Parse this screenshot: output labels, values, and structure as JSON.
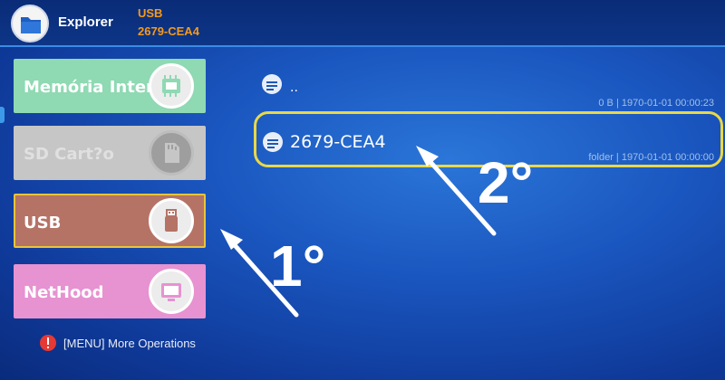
{
  "header": {
    "app_title": "Explorer",
    "path_line1": "USB",
    "path_line2": "2679-CEA4",
    "path_color": "#f59a1b",
    "app_icon": "folder-icon"
  },
  "sidebar": {
    "items": [
      {
        "label": "Memória Interna",
        "icon": "memory-chip-icon",
        "color": "#8fd9b3",
        "state": "normal"
      },
      {
        "label": "SD Cart?o",
        "icon": "sd-card-icon",
        "color": "#c6c6c6",
        "state": "disabled"
      },
      {
        "label": "USB",
        "icon": "usb-drive-icon",
        "color": "#b57366",
        "state": "selected"
      },
      {
        "label": "NetHood",
        "icon": "network-icon",
        "color": "#e792d1",
        "state": "normal"
      }
    ]
  },
  "files": [
    {
      "name": "..",
      "meta": "0 B | 1970-01-01 00:00:23",
      "icon": "list-icon"
    },
    {
      "name": "2679-CEA4",
      "meta": "folder | 1970-01-01 00:00:00",
      "icon": "list-icon",
      "state": "focused"
    }
  ],
  "footer": {
    "hint": "[MENU] More Operations",
    "hint_icon": "alert-icon"
  },
  "annotations": {
    "step1": "1°",
    "step2": "2°"
  },
  "colors": {
    "background": "#1a56bf",
    "focus_border": "#e8d84a",
    "usb_border": "#e8c43a"
  }
}
